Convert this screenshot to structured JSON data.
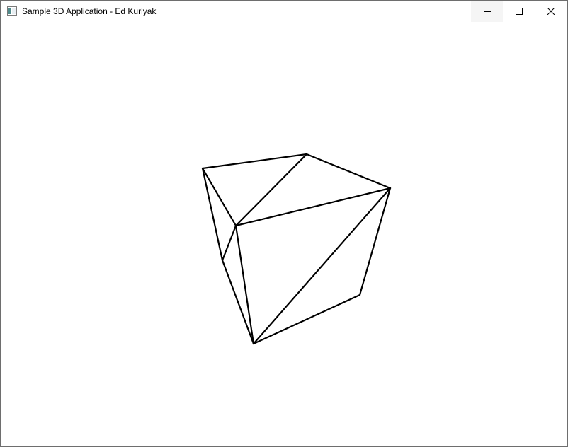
{
  "window": {
    "title": "Sample 3D Application - Ed Kurlyak",
    "icon": "app-window-icon",
    "controls": {
      "minimize": "minimize-icon",
      "maximize": "maximize-icon",
      "close": "close-icon"
    }
  },
  "scene": {
    "object": "wireframe-cube",
    "render_mode": "wireframe",
    "line_color": "#000000",
    "background_color": "#ffffff"
  }
}
